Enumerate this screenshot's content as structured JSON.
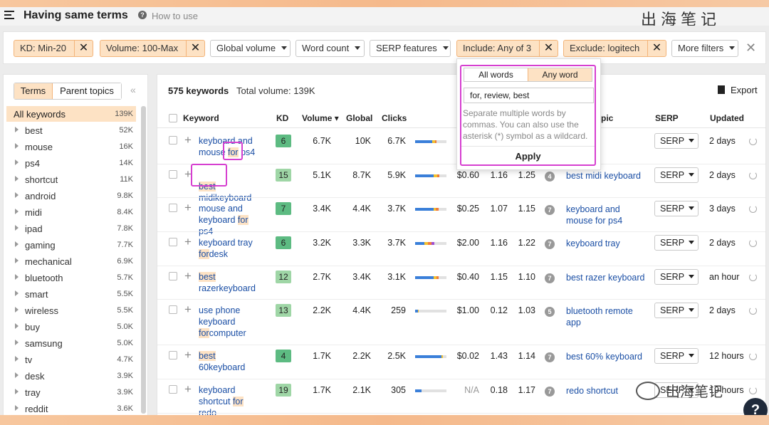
{
  "header": {
    "title": "Having same terms",
    "help_label": "How to use",
    "help_icon": "question-circle-icon",
    "watermark_top": "出海笔记"
  },
  "filters": {
    "kd": "KD: Min-20",
    "volume": "Volume: 100-Max",
    "global_volume": "Global volume",
    "word_count": "Word count",
    "serp_features": "SERP features",
    "include": "Include: Any of 3",
    "exclude": "Exclude: logitech",
    "more_filters": "More filters",
    "remove_glyph": "✕",
    "clear_glyph": "✕"
  },
  "include_popup": {
    "tab_all": "All words",
    "tab_any": "Any word",
    "input_value": "for, review, best",
    "help_text": "Separate multiple words by commas. You can also use the asterisk (*) symbol as a wildcard.",
    "apply_label": "Apply"
  },
  "sidebar": {
    "tab_terms": "Terms",
    "tab_parent": "Parent topics",
    "collapse_glyph": "«",
    "all_label": "All keywords",
    "all_count": "139K",
    "items": [
      {
        "label": "best",
        "count": "52K"
      },
      {
        "label": "mouse",
        "count": "16K"
      },
      {
        "label": "ps4",
        "count": "14K"
      },
      {
        "label": "shortcut",
        "count": "11K"
      },
      {
        "label": "android",
        "count": "9.8K"
      },
      {
        "label": "midi",
        "count": "8.4K"
      },
      {
        "label": "ipad",
        "count": "7.8K"
      },
      {
        "label": "gaming",
        "count": "7.7K"
      },
      {
        "label": "mechanical",
        "count": "6.9K"
      },
      {
        "label": "bluetooth",
        "count": "5.7K"
      },
      {
        "label": "smart",
        "count": "5.5K"
      },
      {
        "label": "wireless",
        "count": "5.5K"
      },
      {
        "label": "buy",
        "count": "5.0K"
      },
      {
        "label": "samsung",
        "count": "5.0K"
      },
      {
        "label": "tv",
        "count": "4.7K"
      },
      {
        "label": "desk",
        "count": "3.9K"
      },
      {
        "label": "tray",
        "count": "3.9K"
      },
      {
        "label": "reddit",
        "count": "3.6K"
      }
    ]
  },
  "main": {
    "keyword_count": "575 keywords",
    "total_volume": "Total volume: 139K",
    "export_label": "Export",
    "columns": {
      "keyword": "Keyword",
      "kd": "KD",
      "volume": "Volume ▾",
      "global": "Global",
      "clicks": "Clicks",
      "parent_topic": "pic",
      "serp": "SERP",
      "updated": "Updated"
    },
    "serp_button": "SERP",
    "rows": [
      {
        "kw": [
          "keyboard and",
          "mouse ",
          "for",
          " ps4"
        ],
        "kd": "6",
        "kd_color": "#5dbb82",
        "volume": "6.7K",
        "global": "10K",
        "clicks": "6.7K",
        "cpc": "",
        "cps": "",
        "rr": "",
        "circle": "",
        "parent": [
          "",
          "l and",
          "r ps4"
        ],
        "updated": "2 days"
      },
      {
        "kw": [
          "",
          "best",
          " midi",
          "keyboard"
        ],
        "kd": "15",
        "kd_color": "#9fd6a6",
        "volume": "5.1K",
        "global": "8.7K",
        "clicks": "5.9K",
        "cpc": "$0.60",
        "cps": "1.16",
        "rr": "1.25",
        "circle": "4",
        "parent": [
          "best midi keyboard"
        ],
        "updated": "2 days"
      },
      {
        "kw": [
          "mouse and",
          "keyboard ",
          "for",
          " ps4"
        ],
        "kd": "7",
        "kd_color": "#5dbb82",
        "volume": "3.4K",
        "global": "4.4K",
        "clicks": "3.7K",
        "cpc": "$0.25",
        "cps": "1.07",
        "rr": "1.15",
        "circle": "7",
        "parent": [
          "keyboard and",
          "mouse for ps4"
        ],
        "updated": "3 days"
      },
      {
        "kw": [
          "keyboard tray ",
          "for",
          "desk"
        ],
        "kd": "6",
        "kd_color": "#5dbb82",
        "volume": "3.2K",
        "global": "3.3K",
        "clicks": "3.7K",
        "cpc": "$2.00",
        "cps": "1.16",
        "rr": "1.22",
        "circle": "7",
        "parent": [
          "keyboard tray"
        ],
        "updated": "2 days"
      },
      {
        "kw": [
          "best",
          " razer",
          "keyboard"
        ],
        "kd": "12",
        "kd_color": "#9fd6a6",
        "volume": "2.7K",
        "global": "3.4K",
        "clicks": "3.1K",
        "cpc": "$0.40",
        "cps": "1.15",
        "rr": "1.10",
        "circle": "7",
        "parent": [
          "best razer keyboard"
        ],
        "updated": "an hour"
      },
      {
        "kw": [
          "use phone",
          "keyboard ",
          "for",
          "computer"
        ],
        "kd": "13",
        "kd_color": "#9fd6a6",
        "volume": "2.2K",
        "global": "4.4K",
        "clicks": "259",
        "cpc": "$1.00",
        "cps": "0.12",
        "rr": "1.03",
        "circle": "5",
        "parent": [
          "bluetooth remote",
          "app"
        ],
        "updated": "2 days"
      },
      {
        "kw": [
          "best",
          " 60",
          "keyboard"
        ],
        "kd": "4",
        "kd_color": "#5dbb82",
        "volume": "1.7K",
        "global": "2.2K",
        "clicks": "2.5K",
        "cpc": "$0.02",
        "cps": "1.43",
        "rr": "1.14",
        "circle": "7",
        "parent": [
          "best 60% keyboard"
        ],
        "updated": "12 hours"
      },
      {
        "kw": [
          "keyboard",
          "shortcut ",
          "for",
          " redo"
        ],
        "kd": "19",
        "kd_color": "#9fd6a6",
        "volume": "1.7K",
        "global": "2.1K",
        "clicks": "305",
        "cpc": "N/A",
        "cps": "0.18",
        "rr": "1.17",
        "circle": "7",
        "parent": [
          "redo shortcut"
        ],
        "updated": "19 hours"
      }
    ],
    "click_bars": [
      {
        "blue": 0.55,
        "yellow": 0.08,
        "orange": 0.06
      },
      {
        "blue": 0.6,
        "yellow": 0.1,
        "orange": 0.08
      },
      {
        "blue": 0.58,
        "yellow": 0.08,
        "orange": 0.08
      },
      {
        "blue": 0.3,
        "yellow": 0.12,
        "orange": 0.1,
        "purple": 0.1
      },
      {
        "blue": 0.6,
        "yellow": 0.08,
        "orange": 0.06
      },
      {
        "blue": 0.08,
        "yellow": 0.04
      },
      {
        "blue": 0.85,
        "yellow": 0.04
      },
      {
        "blue": 0.2
      }
    ]
  },
  "overlay": {
    "watermark_bottom": "出海笔记",
    "help_fab": "?"
  },
  "colors": {
    "accent_orange": "#fde2c4",
    "link_blue": "#1b4fa5",
    "highlight_box": "#d63fd0"
  }
}
